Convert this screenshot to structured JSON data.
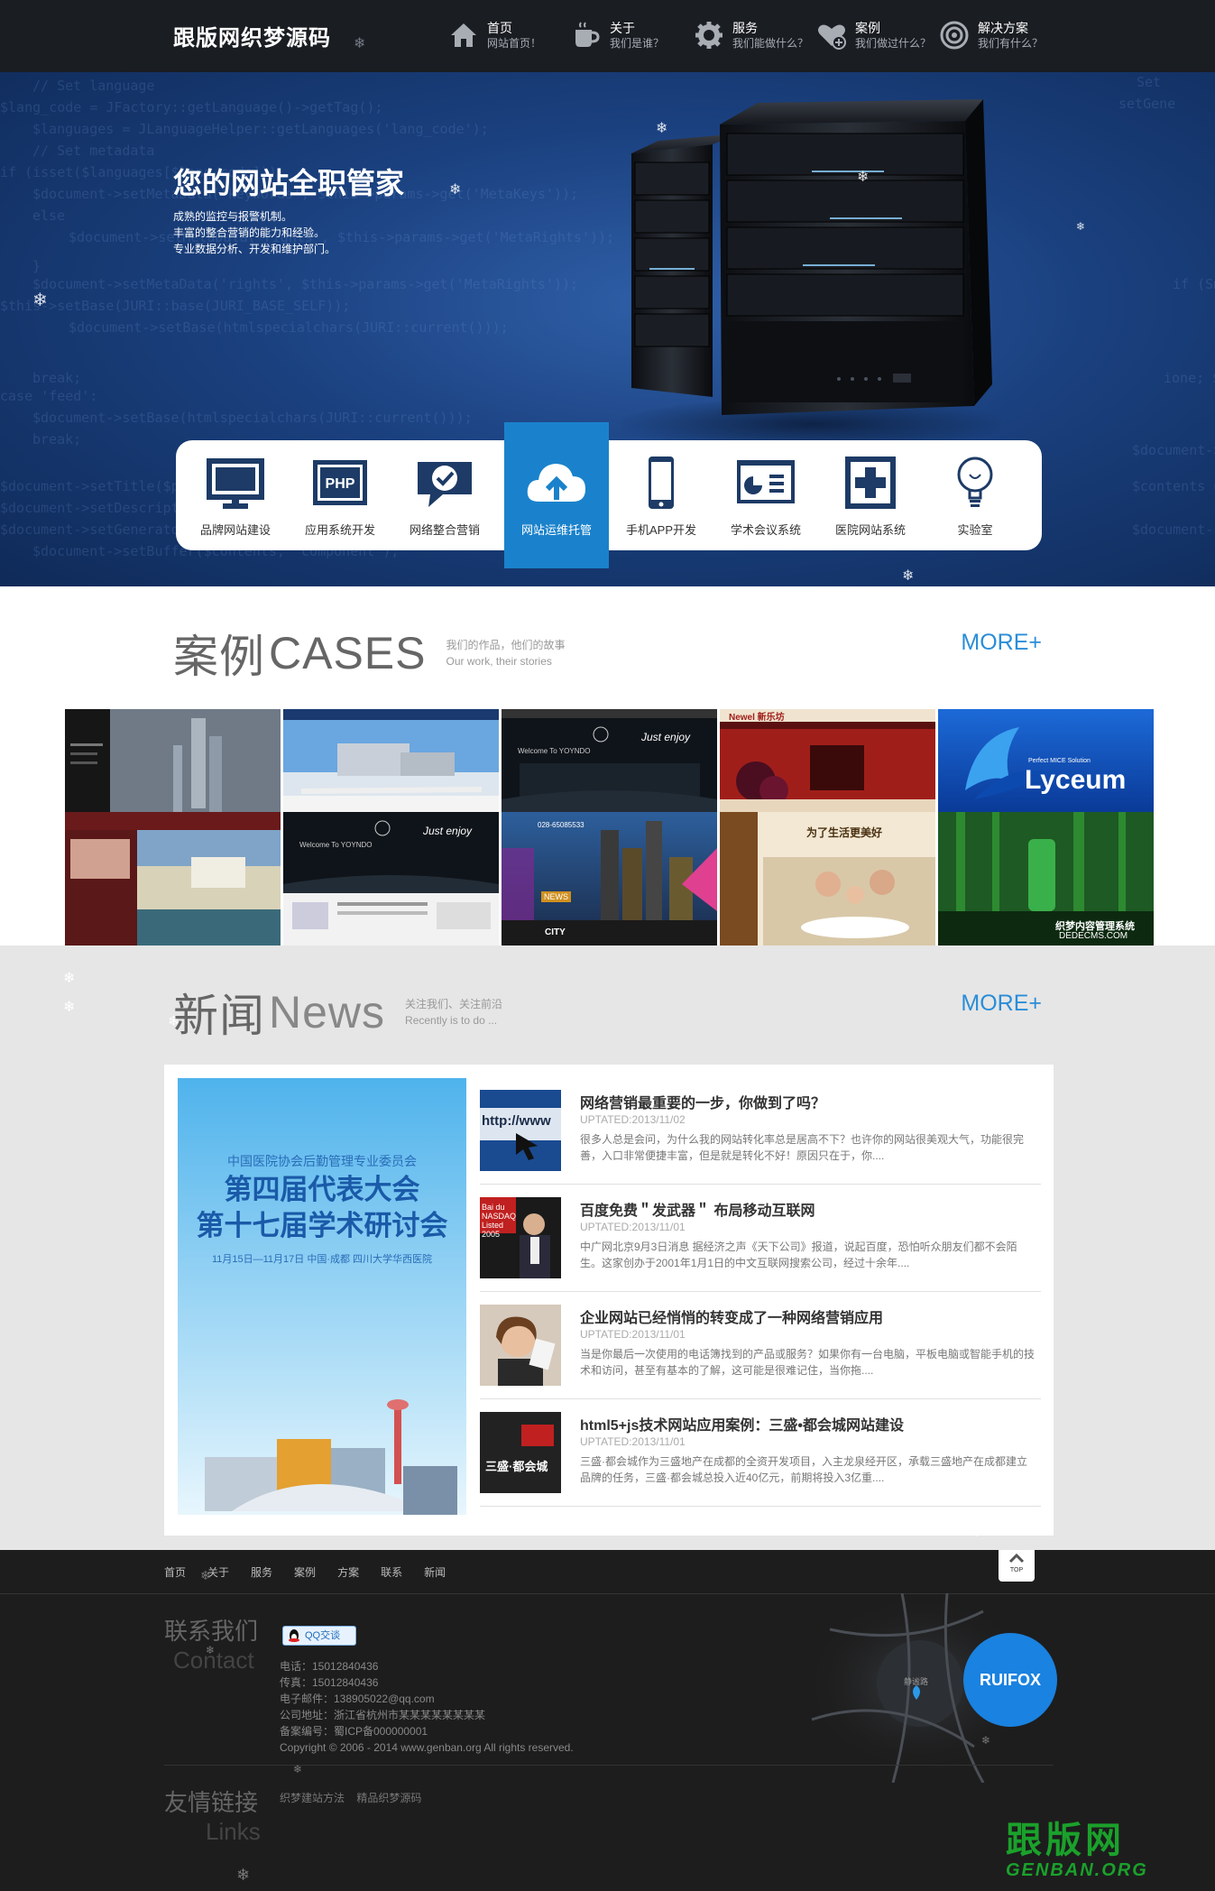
{
  "header": {
    "logo": "跟版网织梦源码",
    "nav": [
      {
        "title": "首页",
        "sub": "网站首页！",
        "icon": "home-icon"
      },
      {
        "title": "关于",
        "sub": "我们是谁？",
        "icon": "cup-icon"
      },
      {
        "title": "服务",
        "sub": "我们能做什么？",
        "icon": "gear-icon"
      },
      {
        "title": "案例",
        "sub": "我们做过什么？",
        "icon": "heart-plus-icon"
      },
      {
        "title": "解决方案",
        "sub": "我们有什么？",
        "icon": "target-icon"
      }
    ]
  },
  "hero": {
    "title": "您的网站全职管家",
    "lines": [
      "成熟的监控与报警机制。",
      "丰富的整合营销的能力和经验。",
      "专业数据分析、开发和维护部门。"
    ],
    "services": [
      {
        "label": "品牌网站建设",
        "icon": "monitor-icon"
      },
      {
        "label": "应用系统开发",
        "icon": "php-icon",
        "badge": "PHP"
      },
      {
        "label": "网络整合营销",
        "icon": "chat-check-icon"
      },
      {
        "label": "网站运维托管",
        "icon": "cloud-upload-icon",
        "active": true
      },
      {
        "label": "手机APP开发",
        "icon": "phone-icon"
      },
      {
        "label": "学术会议系统",
        "icon": "presentation-icon"
      },
      {
        "label": "医院网站系统",
        "icon": "medical-cross-icon"
      },
      {
        "label": "实验室",
        "icon": "lightbulb-icon"
      }
    ]
  },
  "cases": {
    "title_cn": "案例",
    "title_en": "CASES",
    "sub1": "我们的作品，他们的故事",
    "sub2": "Our work, their stories",
    "more": "MORE+",
    "captions": {
      "just_enjoy": "Just enjoy",
      "welcome": "Welcome To YOYNDO",
      "newel": "Newel 新乐坊",
      "lyceum_small": "Perfect MICE Solution",
      "lyceum": "Lyceum",
      "news": "NEWS",
      "city": "CITY",
      "phone": "028-65085533",
      "life": "为了生活更美好",
      "dedecms1": "织梦内容管理系统",
      "dedecms2": "DEDECMS.COM"
    }
  },
  "news": {
    "title_cn": "新闻",
    "title_en": "News",
    "sub1": "关注我们、关注前沿",
    "sub2": "Recently is to do ...",
    "more": "MORE+",
    "feature": {
      "line1": "中国医院协会后勤管理专业委员会",
      "line2": "第四届代表大会",
      "line3": "第十七届学术研讨会",
      "line4": "11月15日—11月17日  中国·成都    四川大学华西医院"
    },
    "items": [
      {
        "title": "网络营销最重要的一步，你做到了吗？",
        "date": "UPTATED:2013/11/02",
        "summary": "很多人总是会问，为什么我的网站转化率总是居高不下？也许你的网站很美观大气，功能很完善，入口非常便捷丰富，但是就是转化不好！原因只在于，你....",
        "thumb_text": "http://www"
      },
      {
        "title": "百度免费＂发武器＂ 布局移动互联网",
        "date": "UPTATED:2013/11/01",
        "summary": "中广网北京9月3日消息 据经济之声《天下公司》报道，说起百度，恐怕听众朋友们都不会陌生。这家创办于2001年1月1日的中文互联网搜索公司，经过十余年....",
        "thumb_text": "Bai du NASDAQ Listed 2005"
      },
      {
        "title": "企业网站已经悄悄的转变成了一种网络营销应用",
        "date": "UPTATED:2013/11/01",
        "summary": "当是你最后一次使用的电话簿找到的产品或服务？如果你有一台电脑，平板电脑或智能手机的技术和访问，甚至有基本的了解，这可能是很难记住，当你拖....",
        "thumb_text": ""
      },
      {
        "title": "html5+js技术网站应用案例：三盛•都会城网站建设",
        "date": "UPTATED:2013/11/01",
        "summary": "三盛·都会城作为三盛地产在成都的全资开发项目，入主龙泉经开区，承载三盛地产在成都建立品牌的任务，三盛·都会城总投入近40亿元，前期将投入3亿重....",
        "thumb_text": "三盛·都会城"
      }
    ]
  },
  "footer": {
    "nav": [
      "首页",
      "关于",
      "服务",
      "案例",
      "方案",
      "联系",
      "新闻"
    ],
    "top_label": "TOP",
    "contact_cn": "联系我们",
    "contact_en": "Contact",
    "qq_label": "QQ交谈",
    "contact_lines": [
      "电话：15012840436",
      "传真：15012840436",
      "电子邮件：138905022@qq.com",
      "公司地址：浙江省杭州市某某某某某某某某",
      "备案编号：蜀ICP备000000001",
      "Copyright © 2006 - 2014 www.genban.org All rights reserved."
    ],
    "links_cn": "友情链接",
    "links_en": "Links",
    "links": [
      "织梦建站方法",
      "精品织梦源码"
    ],
    "map_badge": "RUIFOX",
    "map_label": "静谧路",
    "watermark_cn": "跟版网",
    "watermark_en": "GENBAN.ORG"
  },
  "colors": {
    "accent": "#2a8dd8",
    "hero_blue": "#1a407e",
    "active_service": "#1a82cc",
    "footer": "#1d1d1d",
    "watermark_green": "#1aa12b"
  }
}
